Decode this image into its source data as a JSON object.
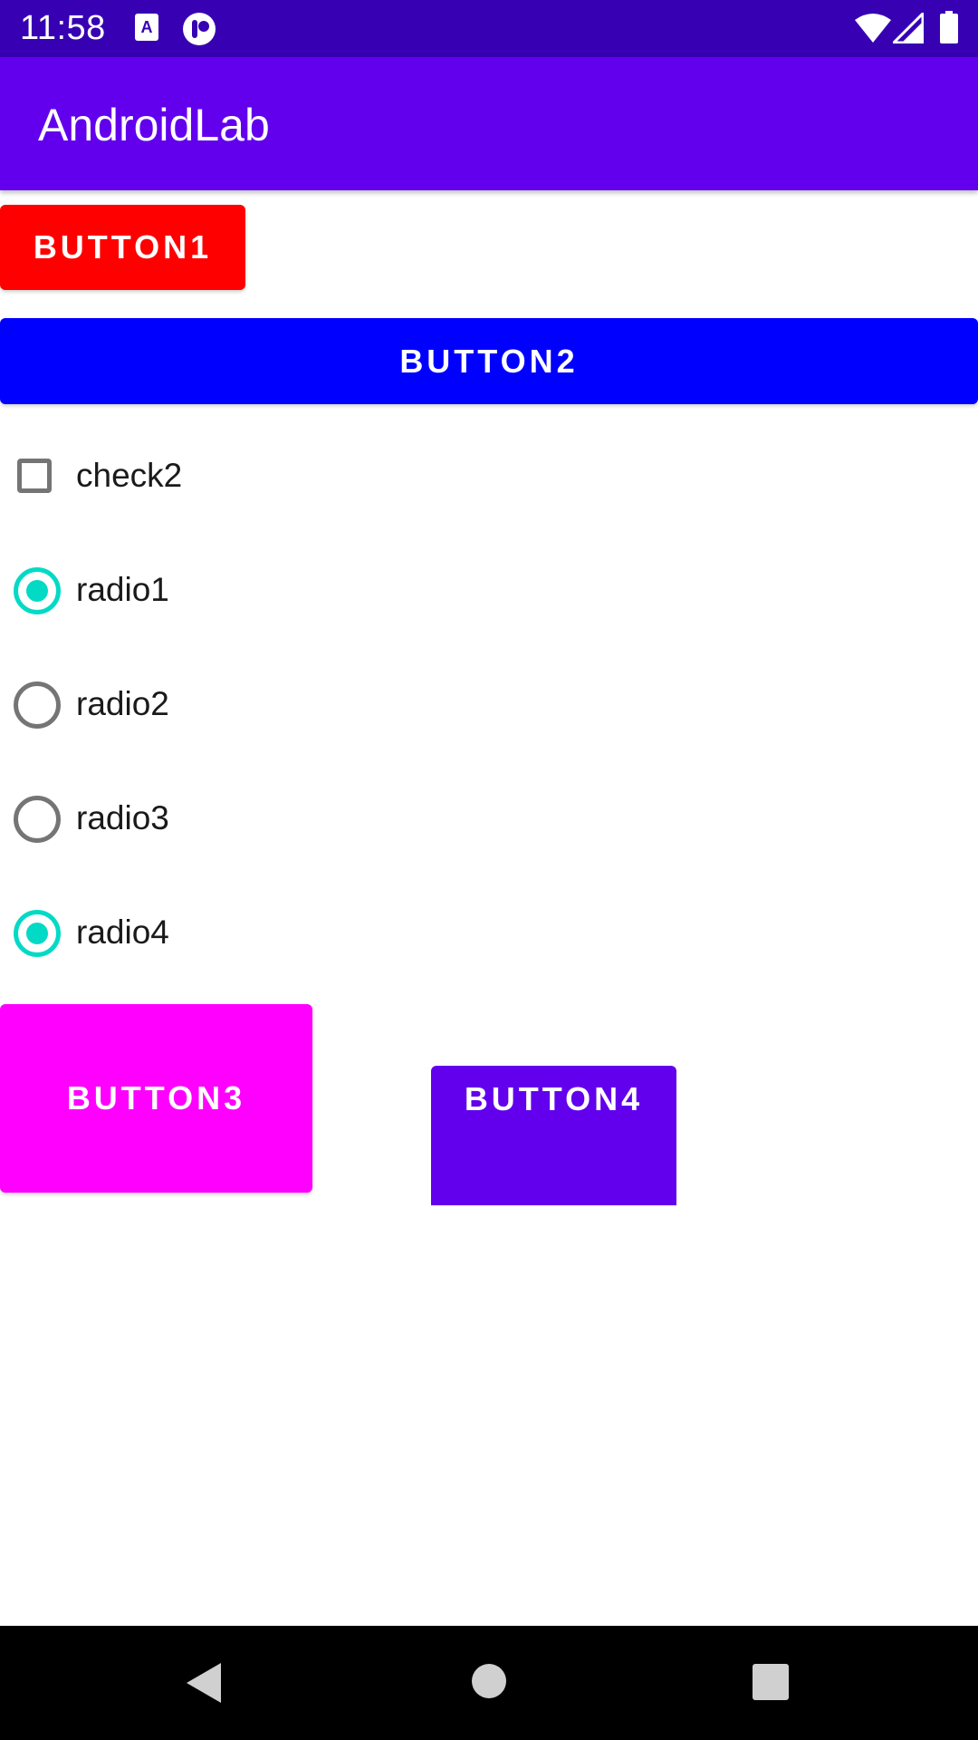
{
  "status_bar": {
    "time": "11:58",
    "icons": [
      "app-a-icon",
      "dnd-icon",
      "wifi-icon",
      "signal-icon",
      "battery-icon"
    ]
  },
  "app_bar": {
    "title": "AndroidLab"
  },
  "buttons": {
    "button1": "BUTTON1",
    "button2": "BUTTON2",
    "button3": "BUTTON3",
    "button4": "BUTTON4"
  },
  "checkbox": {
    "label": "check2",
    "checked": false
  },
  "radios": [
    {
      "label": "radio1",
      "checked": true
    },
    {
      "label": "radio2",
      "checked": false
    },
    {
      "label": "radio3",
      "checked": false
    },
    {
      "label": "radio4",
      "checked": true
    }
  ],
  "nav_bar": {
    "icons": [
      "back-icon",
      "home-icon",
      "recents-icon"
    ]
  },
  "colors": {
    "status_bar": "#3700b3",
    "app_bar": "#6200ee",
    "button1": "#ff0000",
    "button2": "#0000ff",
    "button3": "#ff00ff",
    "button4": "#6200ee",
    "radio_checked": "#03dac5"
  }
}
